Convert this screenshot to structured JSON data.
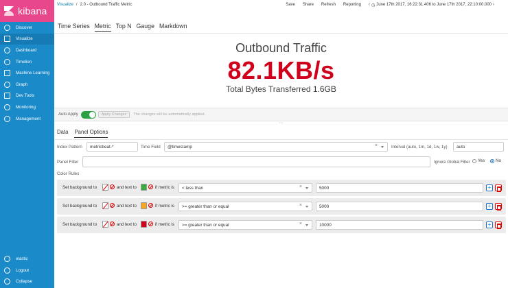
{
  "app": {
    "logo_text": "kibana"
  },
  "sidebar": {
    "items": [
      {
        "label": "Discover",
        "icon": "compass-icon"
      },
      {
        "label": "Visualize",
        "icon": "bar-chart-icon",
        "active": true
      },
      {
        "label": "Dashboard",
        "icon": "dashboard-icon"
      },
      {
        "label": "Timelion",
        "icon": "timelion-icon"
      },
      {
        "label": "Machine Learning",
        "icon": "machine-learning-icon"
      },
      {
        "label": "Graph",
        "icon": "graph-icon"
      },
      {
        "label": "Dev Tools",
        "icon": "wrench-icon"
      },
      {
        "label": "Monitoring",
        "icon": "heartbeat-icon"
      },
      {
        "label": "Management",
        "icon": "gear-icon"
      }
    ],
    "bottom_items": [
      {
        "label": "elastic",
        "icon": "user-icon"
      },
      {
        "label": "Logout",
        "icon": "logout-icon"
      },
      {
        "label": "Collapse",
        "icon": "collapse-icon"
      }
    ]
  },
  "topbar": {
    "breadcrumb_link": "Visualize",
    "breadcrumb_sep": "/",
    "breadcrumb_current": "2.0 - Outbound Traffic Metric",
    "actions": [
      "Save",
      "Share",
      "Refresh",
      "Reporting"
    ],
    "time_range": "June 17th 2017, 16:22:31.406 to June 17th 2017, 22:10:00.000"
  },
  "vis_tabs": [
    "Time Series",
    "Metric",
    "Top N",
    "Gauge",
    "Markdown"
  ],
  "vis_tabs_active": 1,
  "metric": {
    "label": "Outbound Traffic",
    "value": "82.1KB/s",
    "sub_label": "Total Bytes Transferred",
    "sub_value": "1.6GB",
    "value_color": "#d0021b"
  },
  "apply_bar": {
    "auto_apply_label": "Auto Apply",
    "apply_button": "Apply Changes",
    "note": "The changes will be automatically applied."
  },
  "editor": {
    "tabs": [
      "Data",
      "Panel Options"
    ],
    "active_tab": 1,
    "index_pattern_label": "Index Pattern",
    "index_pattern_value": "metricbeat-*",
    "time_field_label": "Time Field",
    "time_field_value": "@timestamp",
    "interval_label": "Interval (auto, 1m, 1d, 1w, 1y)",
    "interval_value": "auto",
    "panel_filter_label": "Panel Filter",
    "panel_filter_value": "",
    "ignore_global_filter_label": "Ignore Global Filter",
    "ignore_yes": "Yes",
    "ignore_no": "No",
    "color_rules_label": "Color Rules",
    "rules": [
      {
        "bg_text": "Set background to",
        "text_text": "and text to",
        "metric_text": "if metric is",
        "text_color": "#3caa3c",
        "operator": "< less than",
        "value": "5000"
      },
      {
        "bg_text": "Set background to",
        "text_text": "and text to",
        "metric_text": "if metric is",
        "text_color": "#f5a623",
        "operator": ">= greater than or equal",
        "value": "5000"
      },
      {
        "bg_text": "Set background to",
        "text_text": "and text to",
        "metric_text": "if metric is",
        "text_color": "#d0021b",
        "operator": ">= greater than or equal",
        "value": "10000"
      }
    ]
  }
}
